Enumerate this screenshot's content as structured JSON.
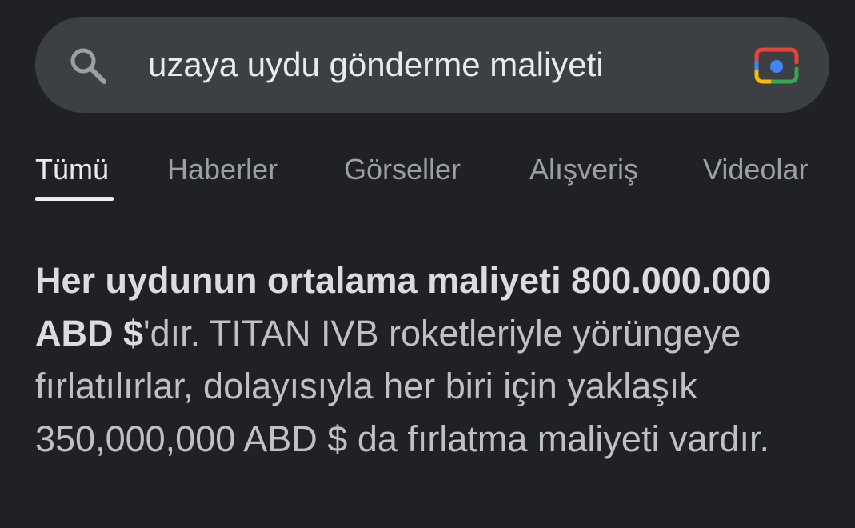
{
  "search": {
    "query": "uzaya uydu gönderme maliyeti",
    "search_icon": "search-icon",
    "lens_icon": "google-lens-icon"
  },
  "tabs": [
    {
      "label": "Tümü",
      "active": true
    },
    {
      "label": "Haberler",
      "active": false
    },
    {
      "label": "Görseller",
      "active": false
    },
    {
      "label": "Alışveriş",
      "active": false
    },
    {
      "label": "Videolar",
      "active": false
    }
  ],
  "answer": {
    "bold_text": "Her uydunun ortalama maliyeti 800.000.000 ABD $",
    "rest_text": "'dır. TITAN IVB roketleriyle yörüngeye fırlatılırlar, dolayısıyla her biri için yaklaşık 350,000,000 ABD $ da fırlatma maliyeti vardır."
  },
  "colors": {
    "background": "#202124",
    "search_bar": "#3c4043",
    "text_primary": "#e8eaed",
    "text_secondary": "#9aa0a6"
  }
}
